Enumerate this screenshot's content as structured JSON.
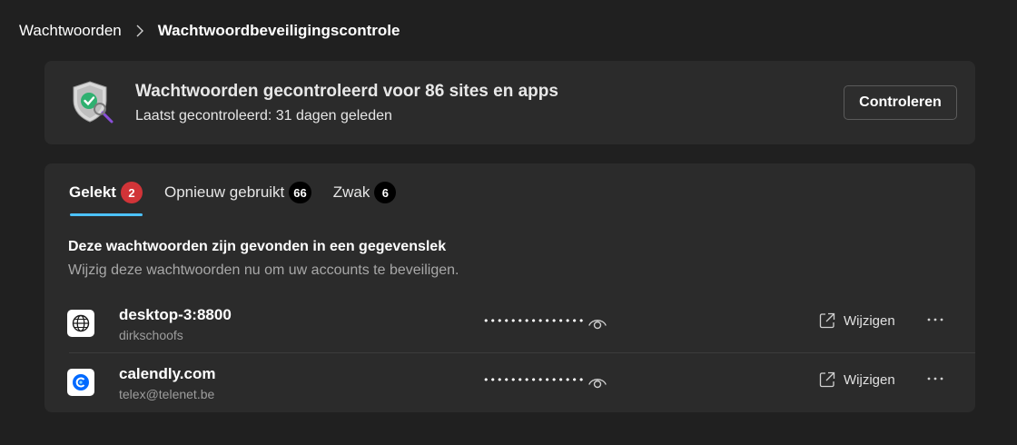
{
  "breadcrumb": {
    "root": "Wachtwoorden",
    "current": "Wachtwoordbeveiligingscontrole"
  },
  "status": {
    "title": "Wachtwoorden gecontroleerd voor 86 sites en apps",
    "subtitle": "Laatst gecontroleerd: 31 dagen geleden",
    "check_button": "Controleren"
  },
  "tabs": [
    {
      "label": "Gelekt",
      "count": "2",
      "active": true
    },
    {
      "label": "Opnieuw gebruikt",
      "count": "66",
      "active": false
    },
    {
      "label": "Zwak",
      "count": "6",
      "active": false
    }
  ],
  "section": {
    "title": "Deze wachtwoorden zijn gevonden in een gegevenslek",
    "subtitle": "Wijzig deze wachtwoorden nu om uw accounts te beveiligen."
  },
  "entries": [
    {
      "site": "desktop-3:8800",
      "username": "dirkschoofs",
      "password_mask": "•••••••••••••••",
      "edit_label": "Wijzigen",
      "icon": "globe-icon"
    },
    {
      "site": "calendly.com",
      "username": "telex@telenet.be",
      "password_mask": "•••••••••••••••",
      "edit_label": "Wijzigen",
      "icon": "calendly-logo-icon"
    }
  ],
  "colors": {
    "background": "#202020",
    "card": "#2b2b2b",
    "accent": "#4cc2ff",
    "badge_alert": "#d13438",
    "shield_green": "#2fb070"
  }
}
